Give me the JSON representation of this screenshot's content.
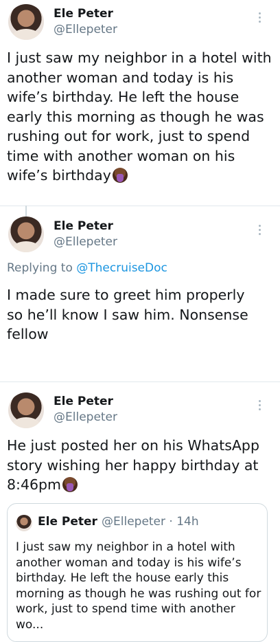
{
  "tweets": [
    {
      "name": "Ele Peter",
      "handle": "@Ellepeter",
      "text": "I just saw my neighbor in a hotel with another woman and today is his wife’s birthday. He left the house early this morning as though he was rushing out for work, just to spend time with another woman on his wife’s birthday",
      "emoji": "person-facepalming-emoji"
    },
    {
      "name": "Ele Peter",
      "handle": "@Ellepeter",
      "reply_prefix": "Replying to ",
      "reply_mention": "@ThecruiseDoc",
      "text": "I made sure to greet him properly so he’ll know I saw him. Nonsense fellow"
    },
    {
      "name": "Ele Peter",
      "handle": "@Ellepeter",
      "text": "He just posted her on his WhatsApp story wishing her happy birthday at 8:46pm",
      "emoji": "person-facepalming-emoji",
      "quote": {
        "name": "Ele Peter",
        "handle_time": "@Ellepeter · 14h",
        "text": "I just saw my neighbor in a hotel with another woman and today is his wife’s birthday. He left the house early this morning as though he was rushing out for work, just to spend time with another wo..."
      }
    }
  ],
  "colors": {
    "text": "#14171a",
    "secondary": "#657786",
    "link": "#1b95e0",
    "divider": "#e1e8ed"
  },
  "icons": [
    "more-options-icon",
    "avatar",
    "facepalm-emoji"
  ]
}
